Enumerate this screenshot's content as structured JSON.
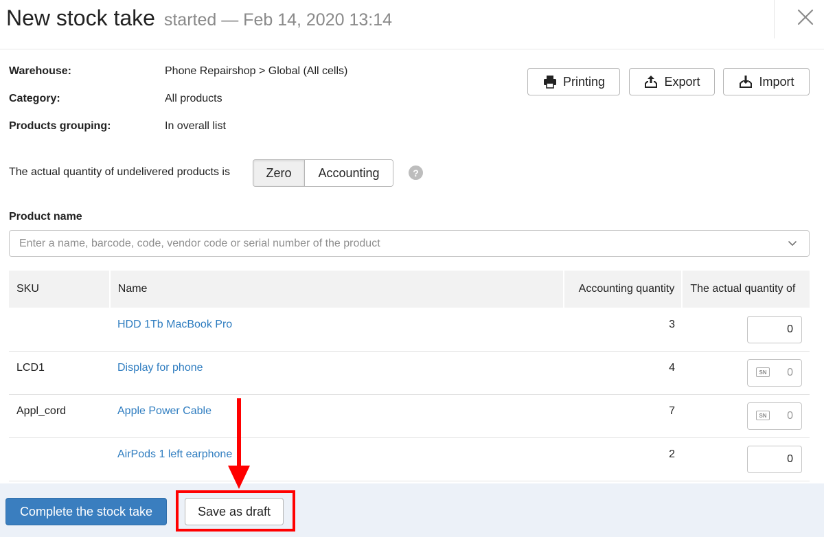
{
  "header": {
    "title": "New stock take",
    "subtitle": "started — Feb 14, 2020 13:14"
  },
  "info": {
    "warehouse_label": "Warehouse:",
    "warehouse_value": "Phone Repairshop > Global (All cells)",
    "category_label": "Category:",
    "category_value": "All products",
    "grouping_label": "Products grouping:",
    "grouping_value": "In overall list"
  },
  "toolbar": {
    "printing": "Printing",
    "export": "Export",
    "import": "Import"
  },
  "undelivered": {
    "label": "The actual quantity of undelivered products is",
    "options": [
      "Zero",
      "Accounting"
    ],
    "selected": "Zero",
    "help": "?"
  },
  "product_search": {
    "label": "Product name",
    "placeholder": "Enter a name, barcode, code, vendor code or serial number of the product"
  },
  "table": {
    "columns": [
      "SKU",
      "Name",
      "Accounting quantity",
      "The actual quantity of"
    ],
    "rows": [
      {
        "sku": "",
        "name": "HDD 1Tb MacBook Pro",
        "accounting": "3",
        "actual": "0",
        "serial": false
      },
      {
        "sku": "LCD1",
        "name": "Display for phone",
        "accounting": "4",
        "actual": "0",
        "serial": true
      },
      {
        "sku": "Appl_cord",
        "name": "Apple Power Cable",
        "accounting": "7",
        "actual": "0",
        "serial": true
      },
      {
        "sku": "",
        "name": "AirPods 1 left earphone",
        "accounting": "2",
        "actual": "0",
        "serial": false
      }
    ],
    "sn_badge": "SN"
  },
  "footer": {
    "complete": "Complete the stock take",
    "draft": "Save as draft"
  },
  "colors": {
    "primary": "#3a7ebf",
    "link": "#2f7dc0",
    "footer_bg": "#ecf1f8",
    "annotation": "#ff0000"
  }
}
